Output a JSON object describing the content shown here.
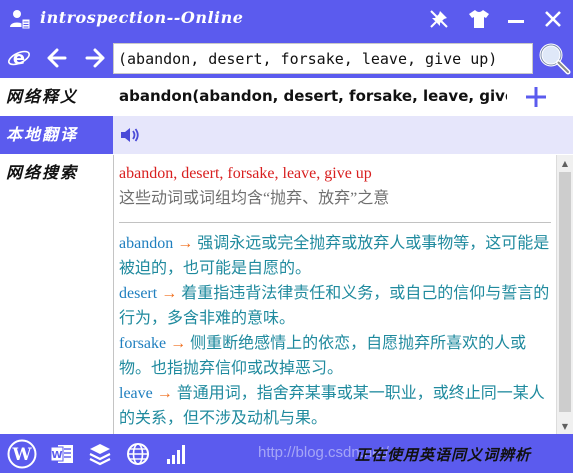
{
  "title": "introspection--Online",
  "search": {
    "value": "(abandon, desert, forsake, leave, give up)"
  },
  "sidebar": {
    "items": [
      {
        "label": "网络释义"
      },
      {
        "label": "本地翻译"
      },
      {
        "label": "网络搜索"
      }
    ]
  },
  "header": {
    "word": "abandon(abandon, desert, forsake, leave, give up)"
  },
  "content": {
    "headword": "abandon, desert, forsake, leave, give up",
    "summary": "这些动词或词组均含“抛弃、放弃”之意",
    "entries": [
      {
        "term": "abandon",
        "arrow": "→",
        "text": " 强调永远或完全抛弃或放弃人或事物等，这可能是被迫的，也可能是自愿的。"
      },
      {
        "term": "desert",
        "arrow": "→",
        "text": " 着重指违背法律责任和义务，或自己的信仰与誓言的行为，多含非难的意味。"
      },
      {
        "term": "forsake",
        "arrow": "→",
        "text": " 侧重断绝感情上的依恋，自愿抛弃所喜欢的人或物。也指抛弃信仰或改掉恶习。"
      },
      {
        "term": "leave",
        "arrow": "→",
        "text": " 普通用词，指舍弃某事或某一职业，或终止同一某人的关系，但不涉及动机与果。"
      }
    ]
  },
  "status": {
    "text": "正在使用英语同义词辨析",
    "watermark": "http://blog.csdn.net/"
  },
  "colors": {
    "accent": "#5b5bee",
    "headword": "#d81f1f",
    "term": "#1f7fbf",
    "arrow": "#f07020",
    "body": "#1f8a9e"
  }
}
